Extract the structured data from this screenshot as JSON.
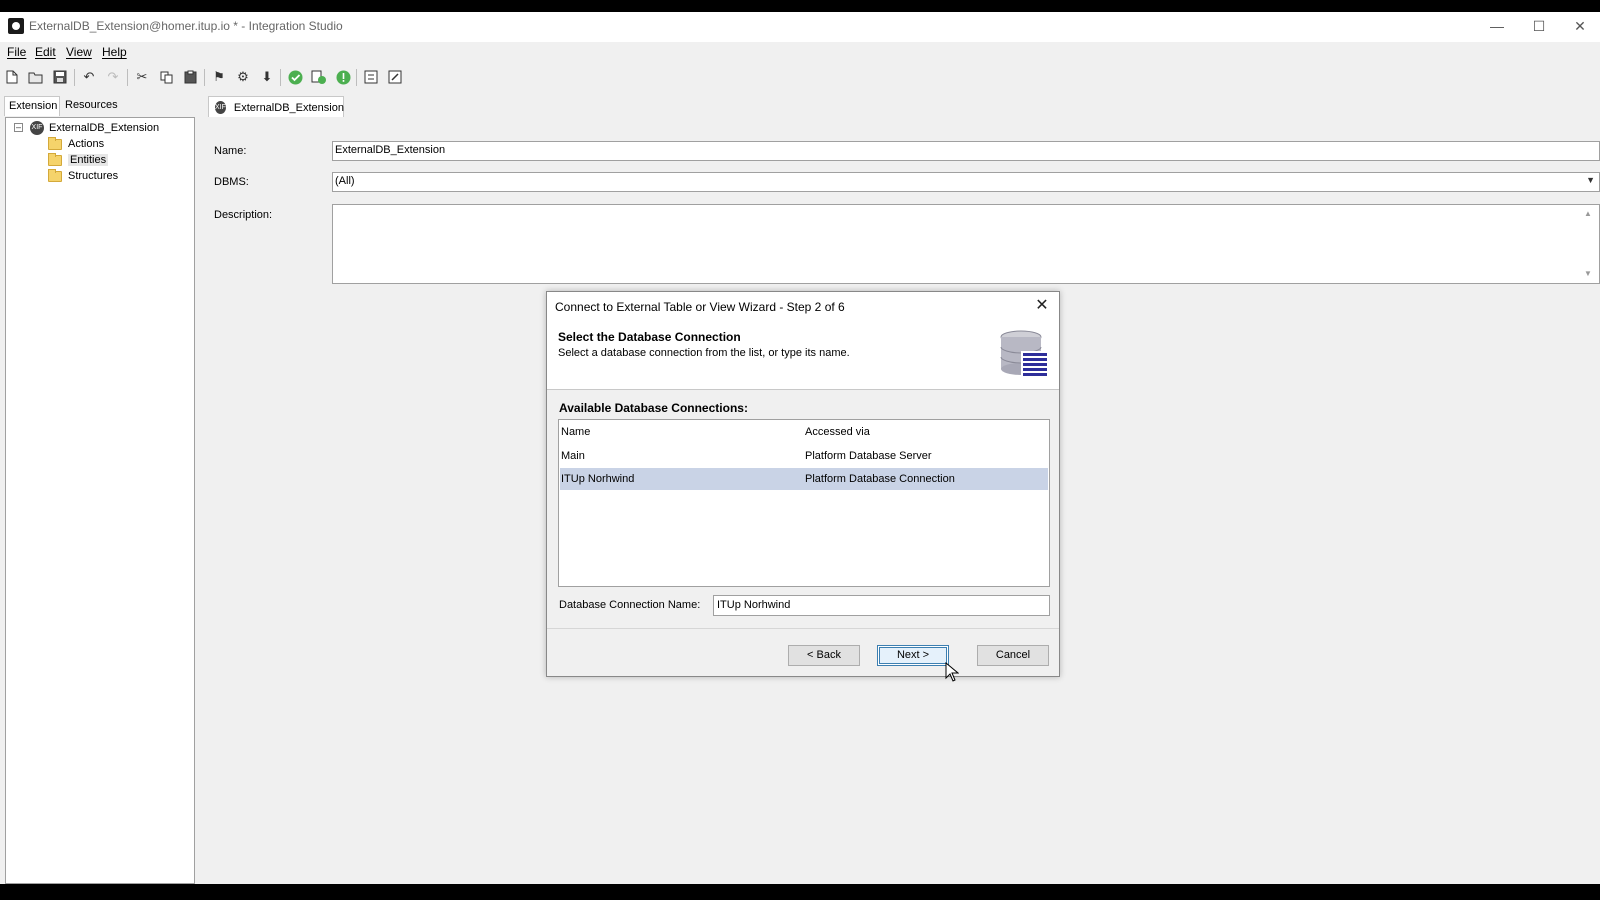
{
  "window": {
    "title": "ExternalDB_Extension@homer.itup.io * - Integration Studio",
    "minimize_icon": "minimize-icon",
    "maximize_icon": "maximize-icon",
    "close_icon": "close-icon"
  },
  "menu": {
    "items": [
      "File",
      "Edit",
      "View",
      "Help"
    ]
  },
  "toolbar": {
    "icons": [
      "new-file-icon",
      "open-folder-icon",
      "save-icon",
      "undo-icon",
      "redo-icon",
      "cut-icon",
      "copy-icon",
      "paste-icon",
      "flag-icon",
      "settings-icon",
      "import-icon",
      "verify-icon",
      "publish-icon",
      "info-icon",
      "refresh-icon",
      "edit-icon"
    ]
  },
  "left_panel": {
    "tabs": [
      "Extension",
      "Resources"
    ],
    "tree": {
      "root": "ExternalDB_Extension",
      "children": [
        "Actions",
        "Entities",
        "Structures"
      ],
      "selected": "Entities"
    }
  },
  "editor": {
    "tab_label": "ExternalDB_Extension",
    "fields": {
      "name_label": "Name:",
      "name_value": "ExternalDB_Extension",
      "dbms_label": "DBMS:",
      "dbms_value": "(All)",
      "description_label": "Description:",
      "description_value": ""
    }
  },
  "dialog": {
    "title": "Connect to External Table or View Wizard - Step 2 of 6",
    "heading": "Select the Database Connection",
    "subheading": "Select a database connection from the list, or type its name.",
    "icon": "database-icon",
    "list_label": "Available Database Connections:",
    "columns": [
      "Name",
      "Accessed via"
    ],
    "rows": [
      {
        "name": "Main",
        "accessed_via": "Platform Database Server",
        "selected": false
      },
      {
        "name": "ITUp Norhwind",
        "accessed_via": "Platform Database Connection",
        "selected": true
      }
    ],
    "connection_name_label": "Database Connection Name:",
    "connection_name_value": "ITUp Norhwind",
    "buttons": {
      "back": "< Back",
      "next": "Next >",
      "cancel": "Cancel"
    }
  }
}
